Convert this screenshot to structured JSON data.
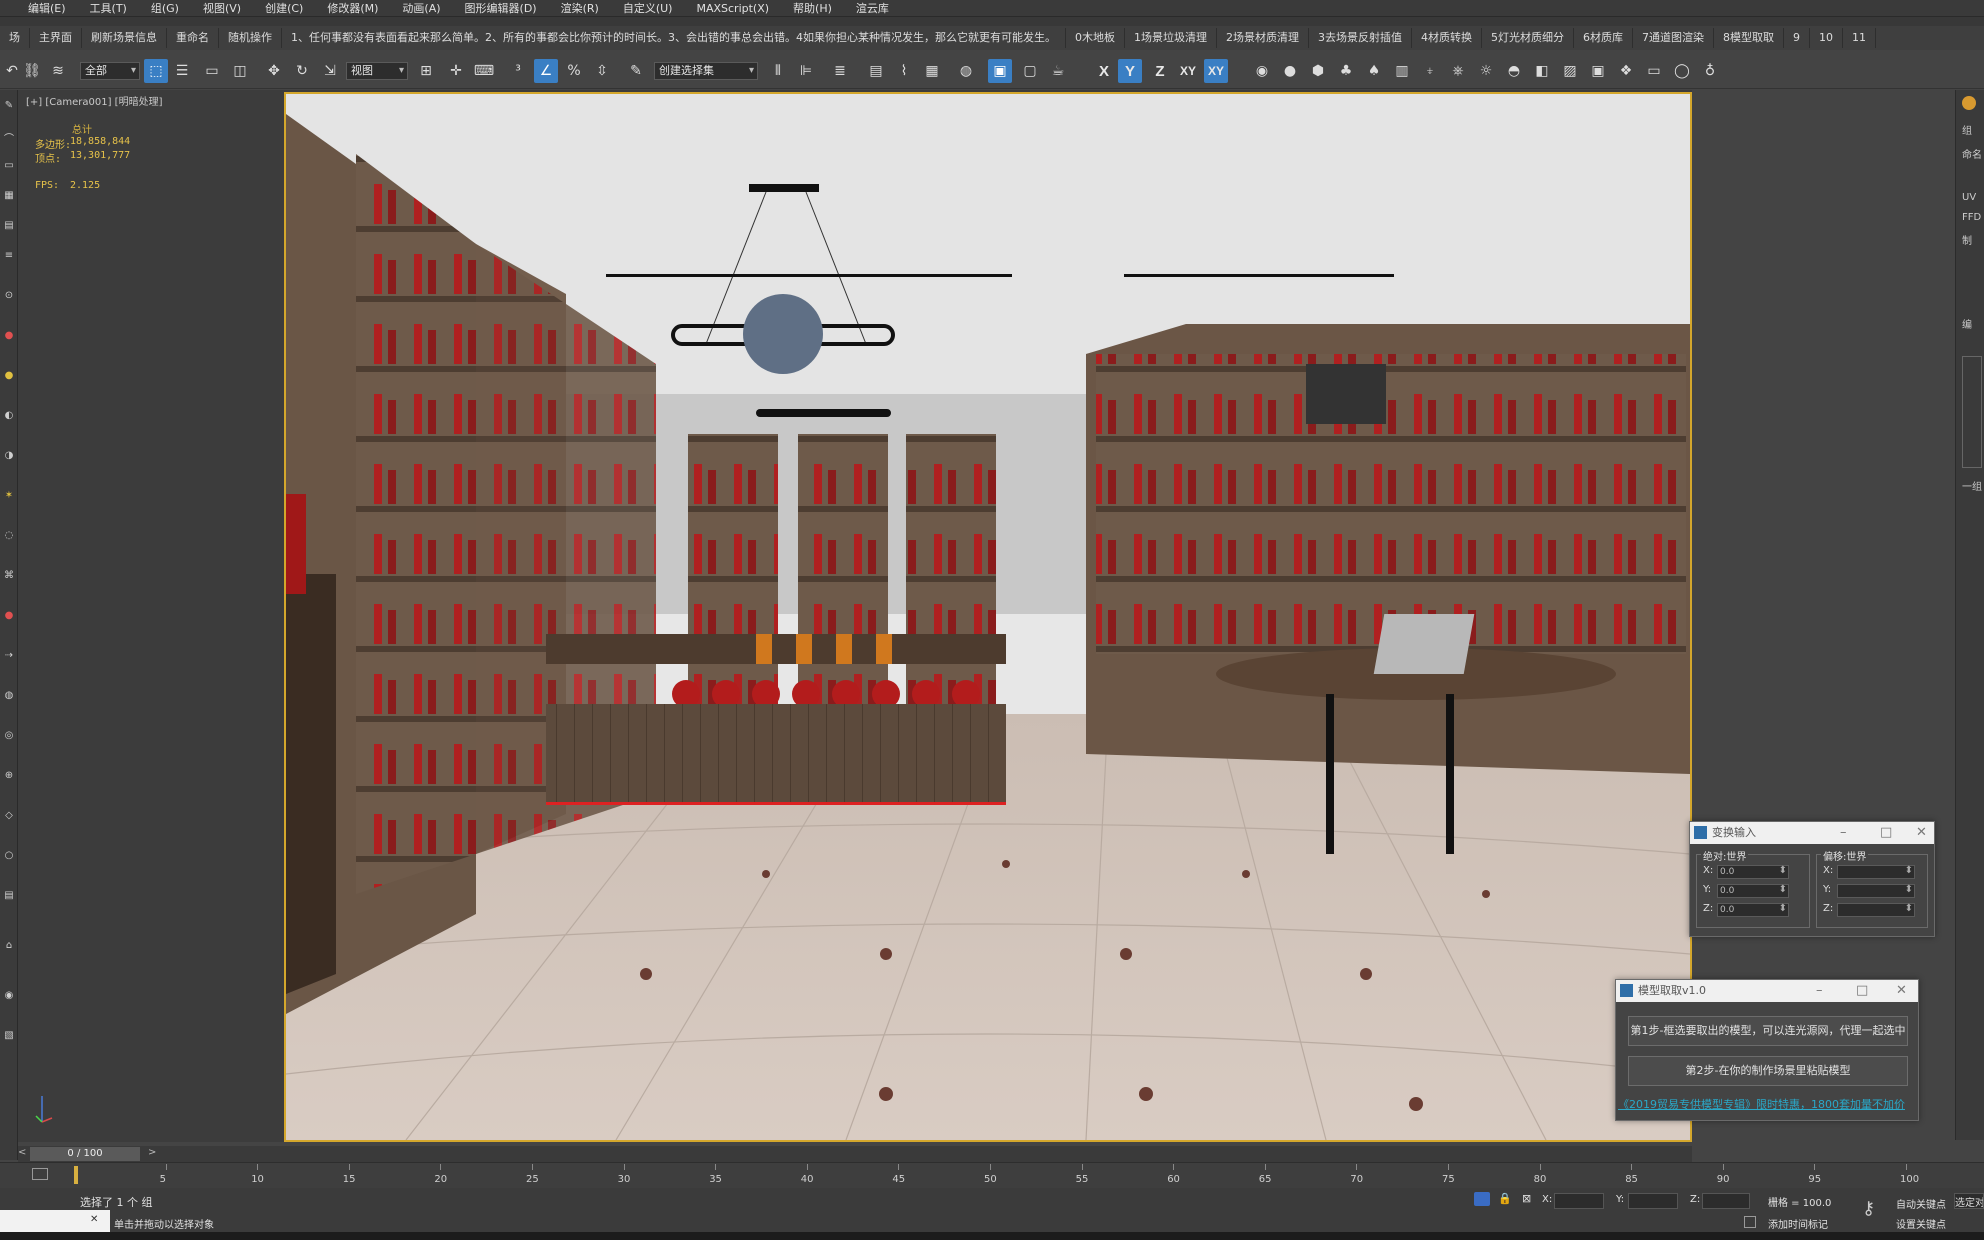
{
  "menu": [
    "编辑(E)",
    "工具(T)",
    "组(G)",
    "视图(V)",
    "创建(C)",
    "修改器(M)",
    "动画(A)",
    "图形编辑器(D)",
    "渲染(R)",
    "自定义(U)",
    "MAXScript(X)",
    "帮助(H)",
    "渲云库"
  ],
  "scriptbar": [
    "场",
    "主界面",
    "刷新场景信息",
    "重命名",
    "随机操作",
    "1、任何事都没有表面看起来那么简单。2、所有的事都会比你预计的时间长。3、会出错的事总会出错。4如果你担心某种情况发生，那么它就更有可能发生。",
    "0木地板",
    "1场景垃圾清理",
    "2场景材质清理",
    "3去场景反射插值",
    "4材质转换",
    "5灯光材质细分",
    "6材质库",
    "7通道图渲染",
    "8模型取取",
    "9",
    "10",
    "11"
  ],
  "toolbar": {
    "selection_filter": "全部",
    "ref_coord": "视图",
    "named_selection": "创建选择集",
    "axis": [
      "X",
      "Y",
      "Z",
      "XY",
      "XY"
    ]
  },
  "viewport": {
    "label": "[+] [Camera001] [明暗处理]",
    "stats_title": "总计",
    "polys_label": "多边形:",
    "polys_value": "18,858,844",
    "verts_label": "顶点:",
    "verts_value": "13,301,777",
    "fps_label": "FPS:",
    "fps_value": "2.125"
  },
  "right_panel": [
    "组",
    "命名",
    "UV",
    "FFD",
    "制",
    "编",
    "一组"
  ],
  "transform_dialog": {
    "title": "变换输入",
    "abs_group": "绝对:世界",
    "off_group": "偏移:世界",
    "abs_x": "0.0",
    "abs_y": "0.0",
    "abs_z": "0.0",
    "x_label": "X:",
    "y_label": "Y:",
    "z_label": "Z:"
  },
  "model_dialog": {
    "title": "模型取取v1.0",
    "step1": "第1步-框选要取出的模型，可以连光源网，代理一起选中",
    "step2": "第2步-在你的制作场景里粘贴模型",
    "link": "《2019贸易专供模型专辑》限时特惠，1800套加量不加价"
  },
  "timeline": {
    "slider": "0 / 100",
    "ticks": [
      "5",
      "10",
      "15",
      "20",
      "25",
      "30",
      "35",
      "40",
      "45",
      "50",
      "55",
      "60",
      "65",
      "70",
      "75",
      "80",
      "85",
      "90",
      "95",
      "100"
    ]
  },
  "status": {
    "selection": "选择了 1 个 组",
    "prompt": "单击并拖动以选择对象",
    "x_label": "X:",
    "y_label": "Y:",
    "z_label": "Z:",
    "grid": "栅格 = 100.0",
    "add_time_tag": "添加时间标记",
    "auto_key": "自动关键点",
    "set_key": "设置关键点",
    "selected": "选定对"
  }
}
